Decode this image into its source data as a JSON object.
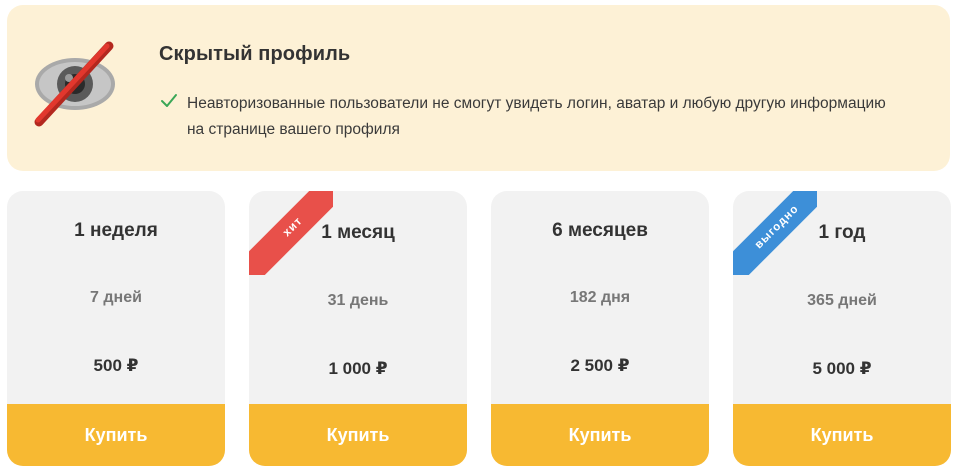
{
  "banner": {
    "title": "Скрытый профиль",
    "icon": "hidden-eye-icon",
    "feature_icon": "check-icon",
    "feature_text": "Неавторизованные пользователи не смогут увидеть логин, аватар и любую другую информацию на странице вашего профиля",
    "background_color": "#fdf1d6"
  },
  "plans": [
    {
      "title": "1 неделя",
      "days": "7 дней",
      "price": "500 ₽",
      "button_label": "Купить",
      "badge": ""
    },
    {
      "title": "1 месяц",
      "days": "31 день",
      "price": "1 000 ₽",
      "button_label": "Купить",
      "badge": "хит",
      "badge_color": "#e8504a"
    },
    {
      "title": "6 месяцев",
      "days": "182 дня",
      "price": "2 500 ₽",
      "button_label": "Купить",
      "badge": ""
    },
    {
      "title": "1 год",
      "days": "365 дней",
      "price": "5 000 ₽",
      "button_label": "Купить",
      "badge": "выгодно",
      "badge_color": "#3d8fd8"
    }
  ],
  "colors": {
    "accent": "#f7b932",
    "card_background": "#f2f2f2",
    "check": "#3aa757"
  }
}
